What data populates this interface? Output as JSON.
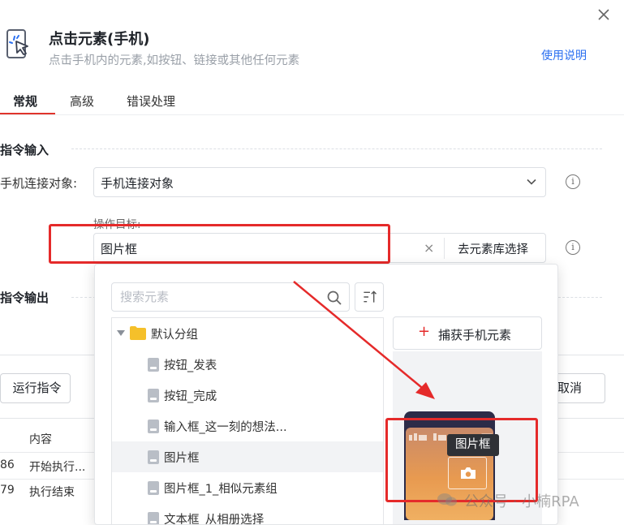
{
  "dialog": {
    "title": "点击元素(手机)",
    "subtitle": "点击手机内的元素,如按钮、链接或其他任何元素",
    "help_link": "使用说明",
    "tabs": [
      {
        "label": "常规",
        "active": true
      },
      {
        "label": "高级",
        "active": false
      },
      {
        "label": "错误处理",
        "active": false
      }
    ],
    "section_input": "指令输入",
    "section_output": "指令输出",
    "phone_label": "手机连接对象:",
    "phone_value": "手机连接对象",
    "target_label": "操作目标:",
    "target_value": "图片框",
    "target_clear": "×",
    "library_select": "去元素库选择",
    "info_glyph": "i",
    "run_button": "运行指令",
    "cancel_button": "取消"
  },
  "element_picker": {
    "search_placeholder": "搜索元素",
    "capture_button": "捕获手机元素",
    "capture_plus": "+",
    "group_name": "默认分组",
    "items": [
      {
        "label": "按钮_发表",
        "selected": false
      },
      {
        "label": "按钮_完成",
        "selected": false
      },
      {
        "label": "输入框_这一刻的想法...",
        "selected": false
      },
      {
        "label": "图片框",
        "selected": true
      },
      {
        "label": "图片框_1_相似元素组",
        "selected": false
      },
      {
        "label": "文本框_从相册选择",
        "selected": false
      }
    ],
    "preview_tooltip": "图片框"
  },
  "background_table": {
    "header_content": "内容",
    "rows": [
      {
        "num": "86",
        "content": "开始执行..."
      },
      {
        "num": "79",
        "content": "执行结束"
      }
    ]
  },
  "watermark": "公众号 · 小楠RPA",
  "colors": {
    "accent_red": "#e0342c",
    "link_blue": "#2a6ff0",
    "annotation_red": "#e52a2a",
    "folder_yellow": "#f5c02a"
  }
}
